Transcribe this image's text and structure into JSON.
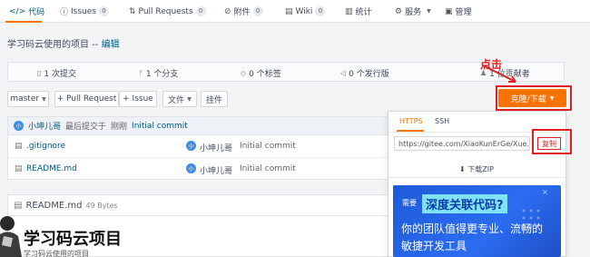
{
  "nav": {
    "tabs": [
      {
        "icon": "</>",
        "label": "代码",
        "badge": ""
      },
      {
        "icon": "ⓘ",
        "label": "Issues",
        "badge": "0"
      },
      {
        "icon": "⇅",
        "label": "Pull Requests",
        "badge": "0"
      },
      {
        "icon": "⊘",
        "label": "附件",
        "badge": "0"
      },
      {
        "icon": "▤",
        "label": "Wiki",
        "badge": "0"
      },
      {
        "icon": "▥",
        "label": "统计",
        "badge": ""
      },
      {
        "icon": "⚙",
        "label": "服务",
        "badge": ""
      },
      {
        "icon": "▣",
        "label": "管理",
        "badge": ""
      }
    ]
  },
  "repo": {
    "description": "学习码云使用的项目 --",
    "edit_label": "编辑"
  },
  "stats": {
    "commits": "1 次提交",
    "branches": "1 个分支",
    "tags": "0 个标签",
    "releases": "0 个发行版",
    "contributors": "1 位贡献者"
  },
  "toolbar": {
    "branch": "master",
    "pull_request": "+ Pull Request",
    "issue": "+ Issue",
    "file": "文件",
    "pendant": "挂件",
    "clone": "克隆/下载"
  },
  "annotation": {
    "text": "点击"
  },
  "last_commit": {
    "avatar_text": "小",
    "author": "小坤儿哥",
    "prefix": "最后提交于",
    "time": "刚刚",
    "message": "Initial commit"
  },
  "files": [
    {
      "icon": "file",
      "name": ".gitignore",
      "author": "小坤儿哥",
      "message": "Initial commit"
    },
    {
      "icon": "file",
      "name": "README.md",
      "author": "小坤儿哥",
      "message": "Initial commit"
    }
  ],
  "readme": {
    "filename": "README.md",
    "size": "49 Bytes",
    "title": "学习码云项目",
    "subtitle": "学习码云使用的项目"
  },
  "clone_dropdown": {
    "tabs": [
      "HTTPS",
      "SSH"
    ],
    "url": "https://gitee.com/XiaoKunErGe/Xue...",
    "copy_label": "复制",
    "download_zip": "下载ZIP"
  },
  "ad": {
    "prefix": "需要",
    "highlight": "深度关联代码?",
    "line2": "你的团队值得更专业、流畅的",
    "line3": "敏捷开发工具",
    "close": "×"
  },
  "colors": {
    "accent": "#fe7300",
    "link": "#005980",
    "annotation_red": "#e02020",
    "ad_blue": "#2b6cf2"
  }
}
